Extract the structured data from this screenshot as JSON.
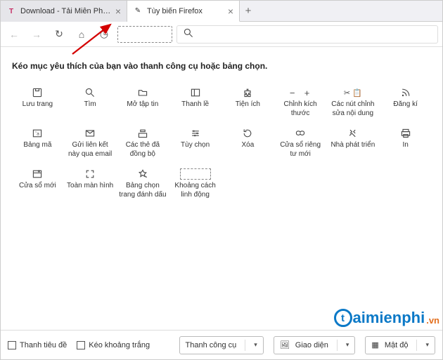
{
  "tabs": {
    "inactive_title": "Download - Tải Miễn Phí VN - C",
    "active_title": "Tùy biến Firefox"
  },
  "toolbar": {
    "search_placeholder": ""
  },
  "instruction": "Kéo mục yêu thích của bạn vào thanh công cụ hoặc bảng chọn.",
  "items": [
    {
      "label": "Lưu trang"
    },
    {
      "label": "Tìm"
    },
    {
      "label": "Mở tập tin"
    },
    {
      "label": "Thanh lề"
    },
    {
      "label": "Tiện ích"
    },
    {
      "label": "Chỉnh kích thước"
    },
    {
      "label": "Các nút chỉnh sửa nội dung"
    },
    {
      "label": "Đăng kí"
    },
    {
      "label": "Bảng mã"
    },
    {
      "label": "Gửi liên kết này qua email"
    },
    {
      "label": "Các thẻ đã đồng bộ"
    },
    {
      "label": "Tùy chọn"
    },
    {
      "label": "Xóa"
    },
    {
      "label": "Cửa sổ riêng tư mới"
    },
    {
      "label": "Nhà phát triển"
    },
    {
      "label": "In"
    },
    {
      "label": "Cửa sổ mới"
    },
    {
      "label": "Toàn màn hình"
    },
    {
      "label": "Bảng chọn trang đánh dấu"
    },
    {
      "label": "Khoảng cách linh động"
    }
  ],
  "bottom": {
    "title_bar": "Thanh tiêu đề",
    "drag_space": "Kéo khoảng trắng",
    "toolbars": "Thanh công cụ",
    "themes": "Giao diện",
    "density": "Mật độ"
  },
  "watermark": {
    "text": "aimienphi",
    "tld": ".vn"
  }
}
